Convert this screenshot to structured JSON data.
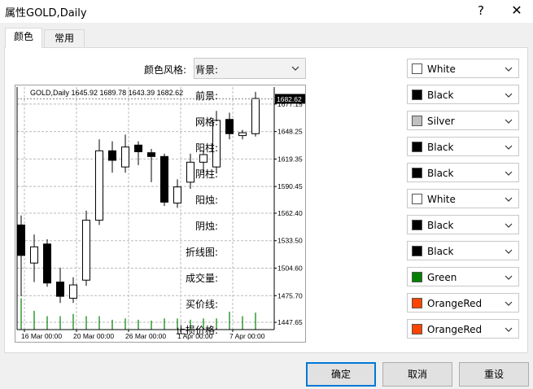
{
  "window": {
    "title": "属性GOLD,Daily",
    "help_glyph": "?",
    "close_glyph": "✕"
  },
  "tabs": [
    {
      "label": "颜色",
      "active": true
    },
    {
      "label": "常用",
      "active": false
    }
  ],
  "scheme": {
    "label": "颜色风格:",
    "value": ""
  },
  "properties": [
    {
      "label": "背景:",
      "color_name": "White",
      "color": "#ffffff"
    },
    {
      "label": "前景:",
      "color_name": "Black",
      "color": "#000000"
    },
    {
      "label": "网格:",
      "color_name": "Silver",
      "color": "#c0c0c0"
    },
    {
      "label": "阳柱:",
      "color_name": "Black",
      "color": "#000000"
    },
    {
      "label": "阴柱:",
      "color_name": "Black",
      "color": "#000000"
    },
    {
      "label": "阳烛:",
      "color_name": "White",
      "color": "#ffffff"
    },
    {
      "label": "阴烛:",
      "color_name": "Black",
      "color": "#000000"
    },
    {
      "label": "折线图:",
      "color_name": "Black",
      "color": "#000000"
    },
    {
      "label": "成交量:",
      "color_name": "Green",
      "color": "#008000"
    },
    {
      "label": "买价线:",
      "color_name": "OrangeRed",
      "color": "#ff4500"
    },
    {
      "label": "止损价格:",
      "color_name": "OrangeRed",
      "color": "#ff4500"
    }
  ],
  "buttons": {
    "ok": "确定",
    "cancel": "取消",
    "reset": "重设"
  },
  "chart_data": {
    "type": "candlestick",
    "header": "GOLD,Daily   1645.92 1689.78 1643.39 1682.62",
    "current_price_label": "1682.62",
    "current_price": 1682.62,
    "y_ticks": [
      1677.15,
      1648.25,
      1619.35,
      1590.45,
      1562.4,
      1533.5,
      1504.6,
      1475.7,
      1447.65
    ],
    "y_tick_labels": [
      "1677.15",
      "1648.25",
      "1619.35",
      "1590.45",
      "1562.40",
      "1533.50",
      "1504.60",
      "1475.70",
      "1447.65"
    ],
    "ylim": [
      1440,
      1695
    ],
    "x_labels": [
      "16 Mar 00:00",
      "20 Mar 00:00",
      "26 Mar 00:00",
      "1 Apr 00:00",
      "7 Apr 00:00"
    ],
    "x_label_index": [
      0,
      4,
      8,
      12,
      16
    ],
    "candles": [
      {
        "o": 1550,
        "h": 1560,
        "l": 1475,
        "c": 1518
      },
      {
        "o": 1510,
        "h": 1540,
        "l": 1490,
        "c": 1527
      },
      {
        "o": 1530,
        "h": 1535,
        "l": 1485,
        "c": 1489
      },
      {
        "o": 1490,
        "h": 1505,
        "l": 1468,
        "c": 1475
      },
      {
        "o": 1473,
        "h": 1495,
        "l": 1468,
        "c": 1487
      },
      {
        "o": 1492,
        "h": 1565,
        "l": 1486,
        "c": 1555
      },
      {
        "o": 1555,
        "h": 1640,
        "l": 1550,
        "c": 1628
      },
      {
        "o": 1628,
        "h": 1638,
        "l": 1605,
        "c": 1618
      },
      {
        "o": 1611,
        "h": 1645,
        "l": 1605,
        "c": 1632
      },
      {
        "o": 1634,
        "h": 1638,
        "l": 1613,
        "c": 1627
      },
      {
        "o": 1626,
        "h": 1630,
        "l": 1595,
        "c": 1622
      },
      {
        "o": 1622,
        "h": 1625,
        "l": 1570,
        "c": 1574
      },
      {
        "o": 1573,
        "h": 1598,
        "l": 1568,
        "c": 1590
      },
      {
        "o": 1595,
        "h": 1625,
        "l": 1588,
        "c": 1616
      },
      {
        "o": 1616,
        "h": 1628,
        "l": 1605,
        "c": 1624
      },
      {
        "o": 1611,
        "h": 1670,
        "l": 1605,
        "c": 1660
      },
      {
        "o": 1661,
        "h": 1668,
        "l": 1640,
        "c": 1646
      },
      {
        "o": 1644,
        "h": 1650,
        "l": 1640,
        "c": 1647
      },
      {
        "o": 1646,
        "h": 1690,
        "l": 1643,
        "c": 1683
      }
    ],
    "volumes": [
      0.7,
      0.42,
      0.3,
      0.3,
      0.35,
      0.3,
      0.3,
      0.22,
      0.25,
      0.22,
      0.2,
      0.25,
      0.25,
      0.22,
      0.25,
      0.25,
      0.4,
      0.3,
      0.38
    ]
  }
}
